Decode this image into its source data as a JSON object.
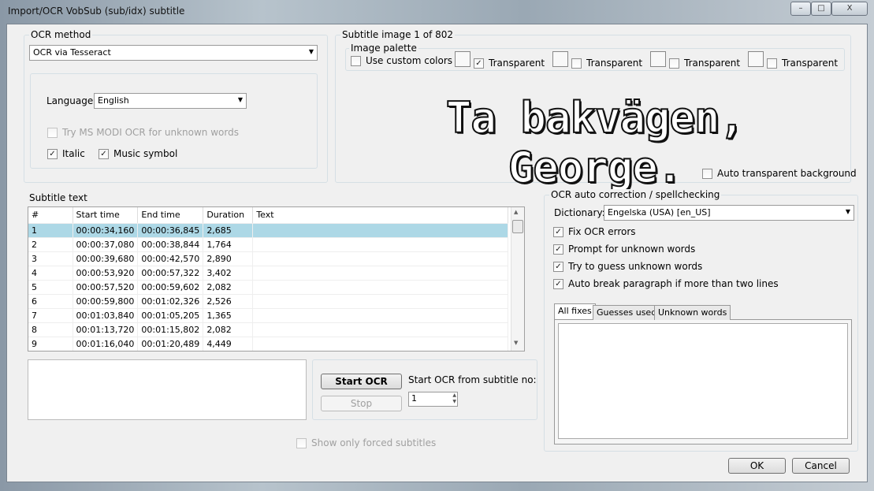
{
  "window": {
    "title": "Import/OCR VobSub (sub/idx) subtitle",
    "min": "–",
    "max": "□",
    "close": "X"
  },
  "ocr_method": {
    "label": "OCR method",
    "selected": "OCR via Tesseract",
    "language_label": "Language",
    "language": "English",
    "modi_label": "Try MS MODI OCR for unknown words",
    "italic_label": "Italic",
    "italic_checked": true,
    "music_label": "Music symbol",
    "music_checked": true
  },
  "subtitle_image": {
    "label": "Subtitle image 1 of 802",
    "palette_label": "Image palette",
    "custom_colors_label": "Use custom colors",
    "transparent_labels": [
      "Transparent",
      "Transparent",
      "Transparent",
      "Transparent"
    ],
    "transparent_checked": [
      true,
      false,
      false,
      false
    ],
    "image_text": "Ta bakvägen, George.",
    "auto_transparent_label": "Auto transparent background"
  },
  "subtitle_text": {
    "label": "Subtitle text",
    "columns": [
      "#",
      "Start time",
      "End time",
      "Duration",
      "Text"
    ],
    "rows": [
      [
        "1",
        "00:00:34,160",
        "00:00:36,845",
        "2,685",
        ""
      ],
      [
        "2",
        "00:00:37,080",
        "00:00:38,844",
        "1,764",
        ""
      ],
      [
        "3",
        "00:00:39,680",
        "00:00:42,570",
        "2,890",
        ""
      ],
      [
        "4",
        "00:00:53,920",
        "00:00:57,322",
        "3,402",
        ""
      ],
      [
        "5",
        "00:00:57,520",
        "00:00:59,602",
        "2,082",
        ""
      ],
      [
        "6",
        "00:00:59,800",
        "00:01:02,326",
        "2,526",
        ""
      ],
      [
        "7",
        "00:01:03,840",
        "00:01:05,205",
        "1,365",
        ""
      ],
      [
        "8",
        "00:01:13,720",
        "00:01:15,802",
        "2,082",
        ""
      ],
      [
        "9",
        "00:01:16,040",
        "00:01:20,489",
        "4,449",
        ""
      ]
    ]
  },
  "controls": {
    "start_ocr": "Start OCR",
    "stop": "Stop",
    "start_from_label": "Start OCR from subtitle no:",
    "start_from_value": "1",
    "forced_label": "Show only forced subtitles"
  },
  "autocorrect": {
    "label": "OCR auto correction / spellchecking",
    "dictionary_label": "Dictionary:",
    "dictionary": "Engelska (USA) [en_US]",
    "options": [
      {
        "label": "Fix OCR errors",
        "checked": true
      },
      {
        "label": "Prompt for unknown words",
        "checked": true
      },
      {
        "label": "Try to guess unknown words",
        "checked": true
      },
      {
        "label": "Auto break paragraph if more than two lines",
        "checked": true
      }
    ],
    "tabs": [
      "All fixes",
      "Guesses used",
      "Unknown words"
    ]
  },
  "footer": {
    "ok": "OK",
    "cancel": "Cancel"
  }
}
